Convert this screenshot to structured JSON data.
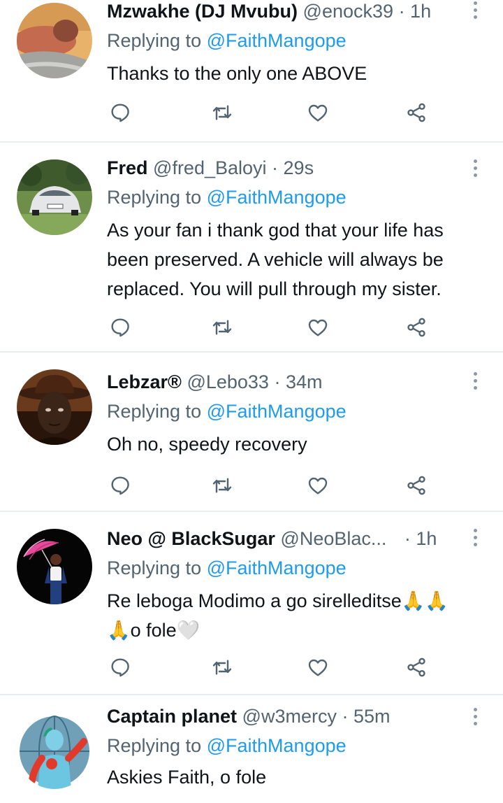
{
  "colors": {
    "text": "#0f1419",
    "muted": "#536471",
    "link": "#1d9bf0",
    "divider": "#e9ecef"
  },
  "tweets": [
    {
      "name": "Mzwakhe (DJ Mvubu)",
      "handle": "@enock39",
      "time": "· 1h",
      "replying_prefix": "Replying to",
      "replying_to": "@FaithMangope",
      "lines": [
        "Thanks to the only one ABOVE"
      ],
      "avatar_icon": "avatar-person-reclining"
    },
    {
      "name": "Fred",
      "handle": "@fred_Baloyi",
      "time": "· 29s",
      "replying_prefix": "Replying to",
      "replying_to": "@FaithMangope",
      "lines": [
        "As your fan i thank god that your life has",
        "been preserved. A vehicle will always be",
        "replaced. You will pull through my sister."
      ],
      "avatar_icon": "avatar-white-car"
    },
    {
      "name": "Lebzar®",
      "handle": "@Lebo33",
      "time": "· 34m",
      "replying_prefix": "Replying to",
      "replying_to": "@FaithMangope",
      "lines": [
        "Oh no, speedy recovery"
      ],
      "avatar_icon": "avatar-man-hat"
    },
    {
      "name": "Neo @ BlackSugar",
      "handle": "@NeoBlac...",
      "time": "· 1h",
      "replying_prefix": "Replying to",
      "replying_to": "@FaithMangope",
      "lines": [
        "Re leboga Modimo a go sirelleditse🙏🙏",
        "🙏o fole🤍"
      ],
      "avatar_icon": "avatar-woman-umbrella"
    },
    {
      "name": "Captain planet",
      "handle": "@w3mercy",
      "time": "· 55m",
      "replying_prefix": "Replying to",
      "replying_to": "@FaithMangope",
      "lines": [
        "Askies Faith, o fole"
      ],
      "avatar_icon": "avatar-captain-planet"
    }
  ]
}
